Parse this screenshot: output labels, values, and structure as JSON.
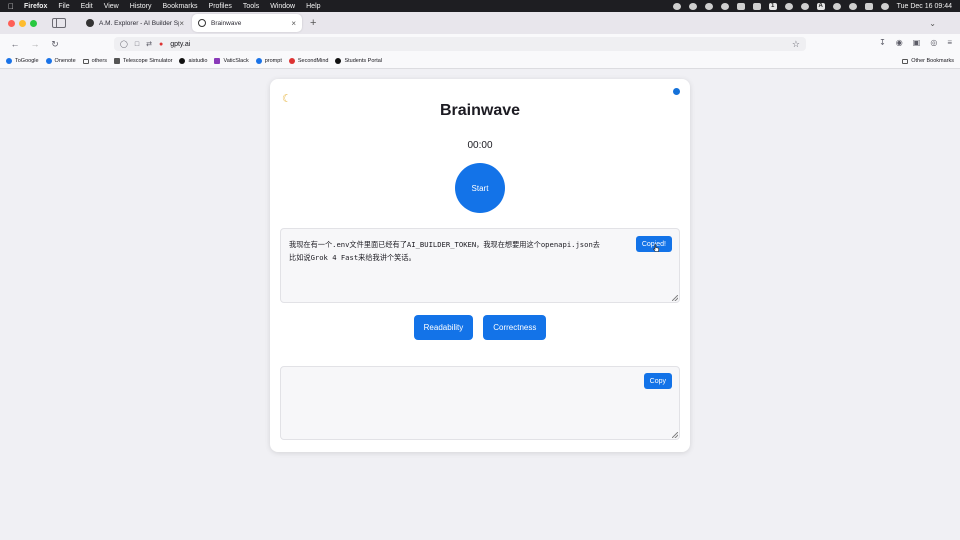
{
  "menubar": {
    "apple_icon": "apple-icon",
    "app_name": "Firefox",
    "items": [
      "File",
      "Edit",
      "View",
      "History",
      "Bookmarks",
      "Profiles",
      "Tools",
      "Window",
      "Help"
    ],
    "status_icons": [
      "mic-icon",
      "record-icon",
      "half-circle-icon",
      "moon-icon",
      "battery-icon",
      "screen-icon",
      "1password-icon",
      "wechat-icon",
      "play-icon",
      "input-method-icon",
      "wifi-icon",
      "search-icon",
      "control-center-icon",
      "siri-icon"
    ],
    "input_method_label": "A",
    "onepass_label": "1",
    "clock": "Tue Dec 16  09:44"
  },
  "tabs": [
    {
      "title": "A.M. Explorer - AI Builder Space",
      "active": false,
      "icon": "ai-builder-icon"
    },
    {
      "title": "Brainwave",
      "active": true,
      "icon": "globe-icon"
    }
  ],
  "nav": {
    "url": "gpty.ai",
    "url_prefix": " "
  },
  "bookmarks": [
    {
      "label": "ToGoogle",
      "icon": "globe-icon"
    },
    {
      "label": "Onenote",
      "icon": "cloud-icon"
    },
    {
      "label": "others",
      "icon": "folder-icon"
    },
    {
      "label": "Telescope Simulator",
      "icon": "telescope-icon"
    },
    {
      "label": "aistudio",
      "icon": "aistudio-icon"
    },
    {
      "label": "VaticSlack",
      "icon": "slack-icon"
    },
    {
      "label": "prompt",
      "icon": "globe-icon"
    },
    {
      "label": "SecondMind",
      "icon": "secondmind-icon"
    },
    {
      "label": "Students Portal",
      "icon": "portal-icon"
    }
  ],
  "other_bookmarks": "Other Bookmarks",
  "app": {
    "title": "Brainwave",
    "timer": "00:00",
    "start_label": "Start",
    "input_text": "我现在有一个.env文件里面已经有了AI_BUILDER_TOKEN，我现在想要用这个openapi.json去\n比如说Grok 4 Fast来给我讲个笑话。",
    "input_copy_label": "Copied!",
    "readability_label": "Readability",
    "correctness_label": "Correctness",
    "output_text": "",
    "output_copy_label": "Copy"
  },
  "colors": {
    "accent": "#1373e8",
    "status_dot": "#1471d9"
  }
}
